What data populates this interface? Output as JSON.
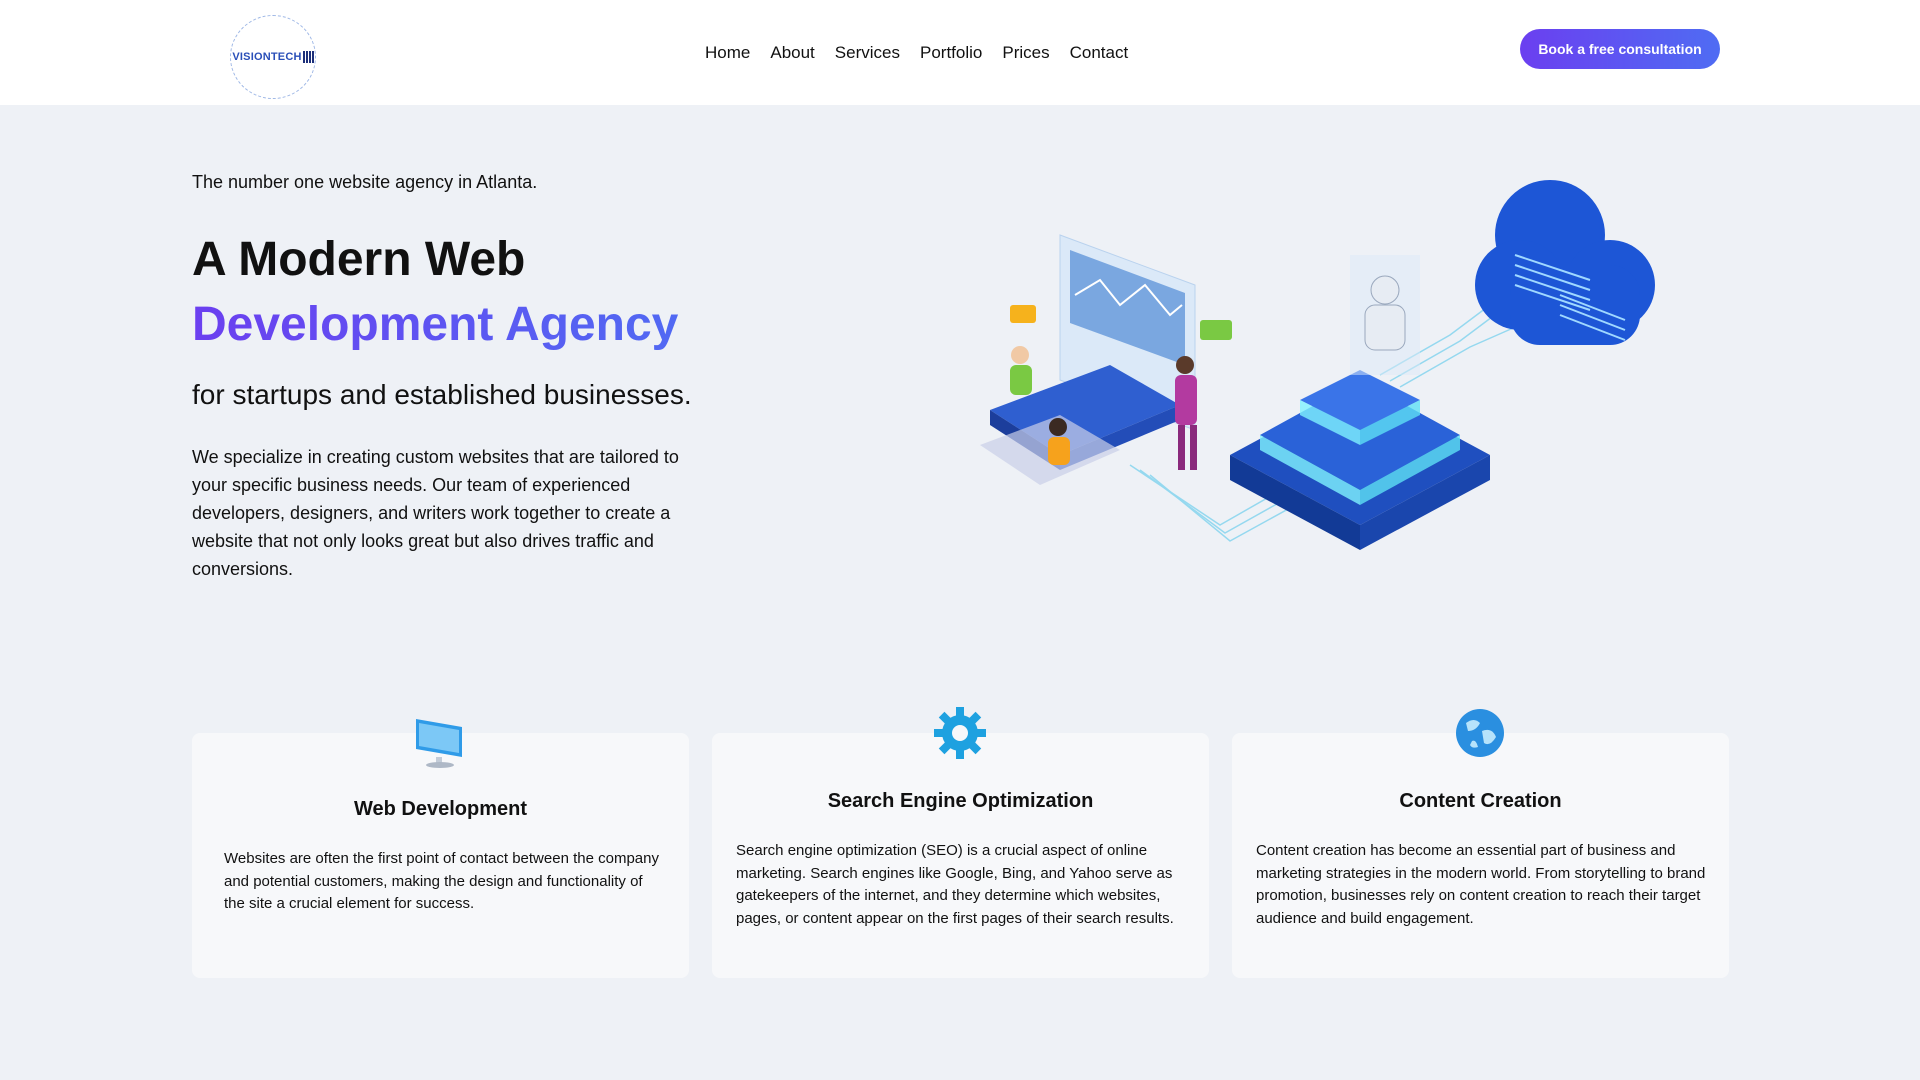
{
  "header": {
    "logo_text": "VISIONTECH",
    "nav": [
      "Home",
      "About",
      "Services",
      "Portfolio",
      "Prices",
      "Contact"
    ],
    "cta_label": "Book a free consultation"
  },
  "hero": {
    "tagline": "The number one website agency in Atlanta.",
    "title_line1": "A Modern Web",
    "title_line2": "Development Agency",
    "subtitle": "for startups and established businesses.",
    "description": "We specialize in creating custom websites that are tailored to your specific business needs. Our team of experienced developers, designers, and writers work together to create a website that not only looks great but also drives traffic and conversions."
  },
  "services": [
    {
      "icon": "monitor-icon",
      "title": "Web Development",
      "text": "Websites are often the first point of contact between the company and potential customers, making the design and functionality of the site a crucial element for success."
    },
    {
      "icon": "gear-icon",
      "title": "Search Engine Optimization",
      "text": "Search engine optimization (SEO) is a crucial aspect of online marketing. Search engines like Google, Bing, and Yahoo serve as gatekeepers of the internet, and they determine which websites, pages, or content appear on the first pages of their search results."
    },
    {
      "icon": "globe-icon",
      "title": "Content Creation",
      "text": "Content creation has become an essential part of business and marketing strategies in the modern world. From storytelling to brand promotion, businesses rely on content creation to reach their target audience and build engagement."
    }
  ],
  "colors": {
    "accent_start": "#6b3ff0",
    "accent_end": "#4f6cf3",
    "page_bg": "#eef1f6",
    "card_bg": "#f7f8fa"
  }
}
